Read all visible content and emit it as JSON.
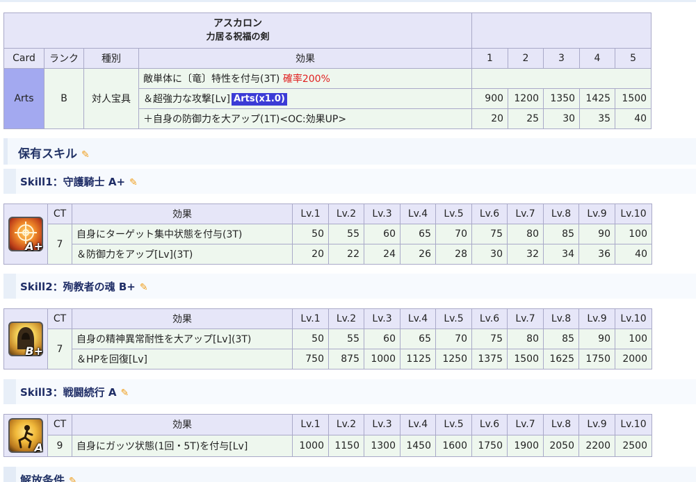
{
  "np": {
    "name": "アスカロン",
    "subtitle": "力居る祝福の剣",
    "headers": {
      "card": "Card",
      "rank": "ランク",
      "type": "種別",
      "effect": "効果",
      "levels": [
        "1",
        "2",
        "3",
        "4",
        "5"
      ]
    },
    "card": "Arts",
    "rank": "B",
    "type": "対人宝具",
    "rows": [
      {
        "text": "敵単体に〔竜〕特性を付与(3T) ",
        "highlight": "確率200%",
        "values": [
          "",
          "",
          "",
          "",
          ""
        ]
      },
      {
        "text": "＆超強力な攻撃[Lv]",
        "tag": "Arts(x1.0)",
        "values": [
          "900",
          "1200",
          "1350",
          "1425",
          "1500"
        ]
      },
      {
        "text": "＋自身の防御力を大アップ(1T)<OC:効果UP>",
        "values": [
          "20",
          "25",
          "30",
          "35",
          "40"
        ]
      }
    ]
  },
  "skills_section": {
    "title": "保有スキル"
  },
  "skills": [
    {
      "title": "Skill1：守護騎士 A+",
      "icon": "crosshair-icon",
      "rank": "A+",
      "ct": "7",
      "rows": [
        {
          "text": "自身にターゲット集中状態を付与(3T)",
          "values": [
            "50",
            "55",
            "60",
            "65",
            "70",
            "75",
            "80",
            "85",
            "90",
            "100"
          ]
        },
        {
          "text": "＆防御力をアップ[Lv](3T)",
          "values": [
            "20",
            "22",
            "24",
            "26",
            "28",
            "30",
            "32",
            "34",
            "36",
            "40"
          ]
        }
      ]
    },
    {
      "title": "Skill2：殉教者の魂 B+",
      "icon": "hooded-figure-icon",
      "rank": "B+",
      "ct": "7",
      "rows": [
        {
          "text": "自身の精神異常耐性を大アップ[Lv](3T)",
          "values": [
            "50",
            "55",
            "60",
            "65",
            "70",
            "75",
            "80",
            "85",
            "90",
            "100"
          ]
        },
        {
          "text": "＆HPを回復[Lv]",
          "values": [
            "750",
            "875",
            "1000",
            "1125",
            "1250",
            "1375",
            "1500",
            "1625",
            "1750",
            "2000"
          ]
        }
      ]
    },
    {
      "title": "Skill3：戦闘続行 A",
      "icon": "kneeling-figure-icon",
      "rank": "A",
      "ct": "9",
      "rows": [
        {
          "text": "自身にガッツ状態(1回・5T)を付与[Lv]",
          "values": [
            "1000",
            "1150",
            "1300",
            "1450",
            "1600",
            "1750",
            "1900",
            "2050",
            "2200",
            "2500"
          ]
        }
      ]
    }
  ],
  "skill_headers": {
    "ct": "CT",
    "effect": "効果",
    "levels": [
      "Lv.1",
      "Lv.2",
      "Lv.3",
      "Lv.4",
      "Lv.5",
      "Lv.6",
      "Lv.7",
      "Lv.8",
      "Lv.9",
      "Lv.10"
    ]
  },
  "bottom_section": {
    "title": "解放条件"
  },
  "edit_icon": "pencil-icon"
}
